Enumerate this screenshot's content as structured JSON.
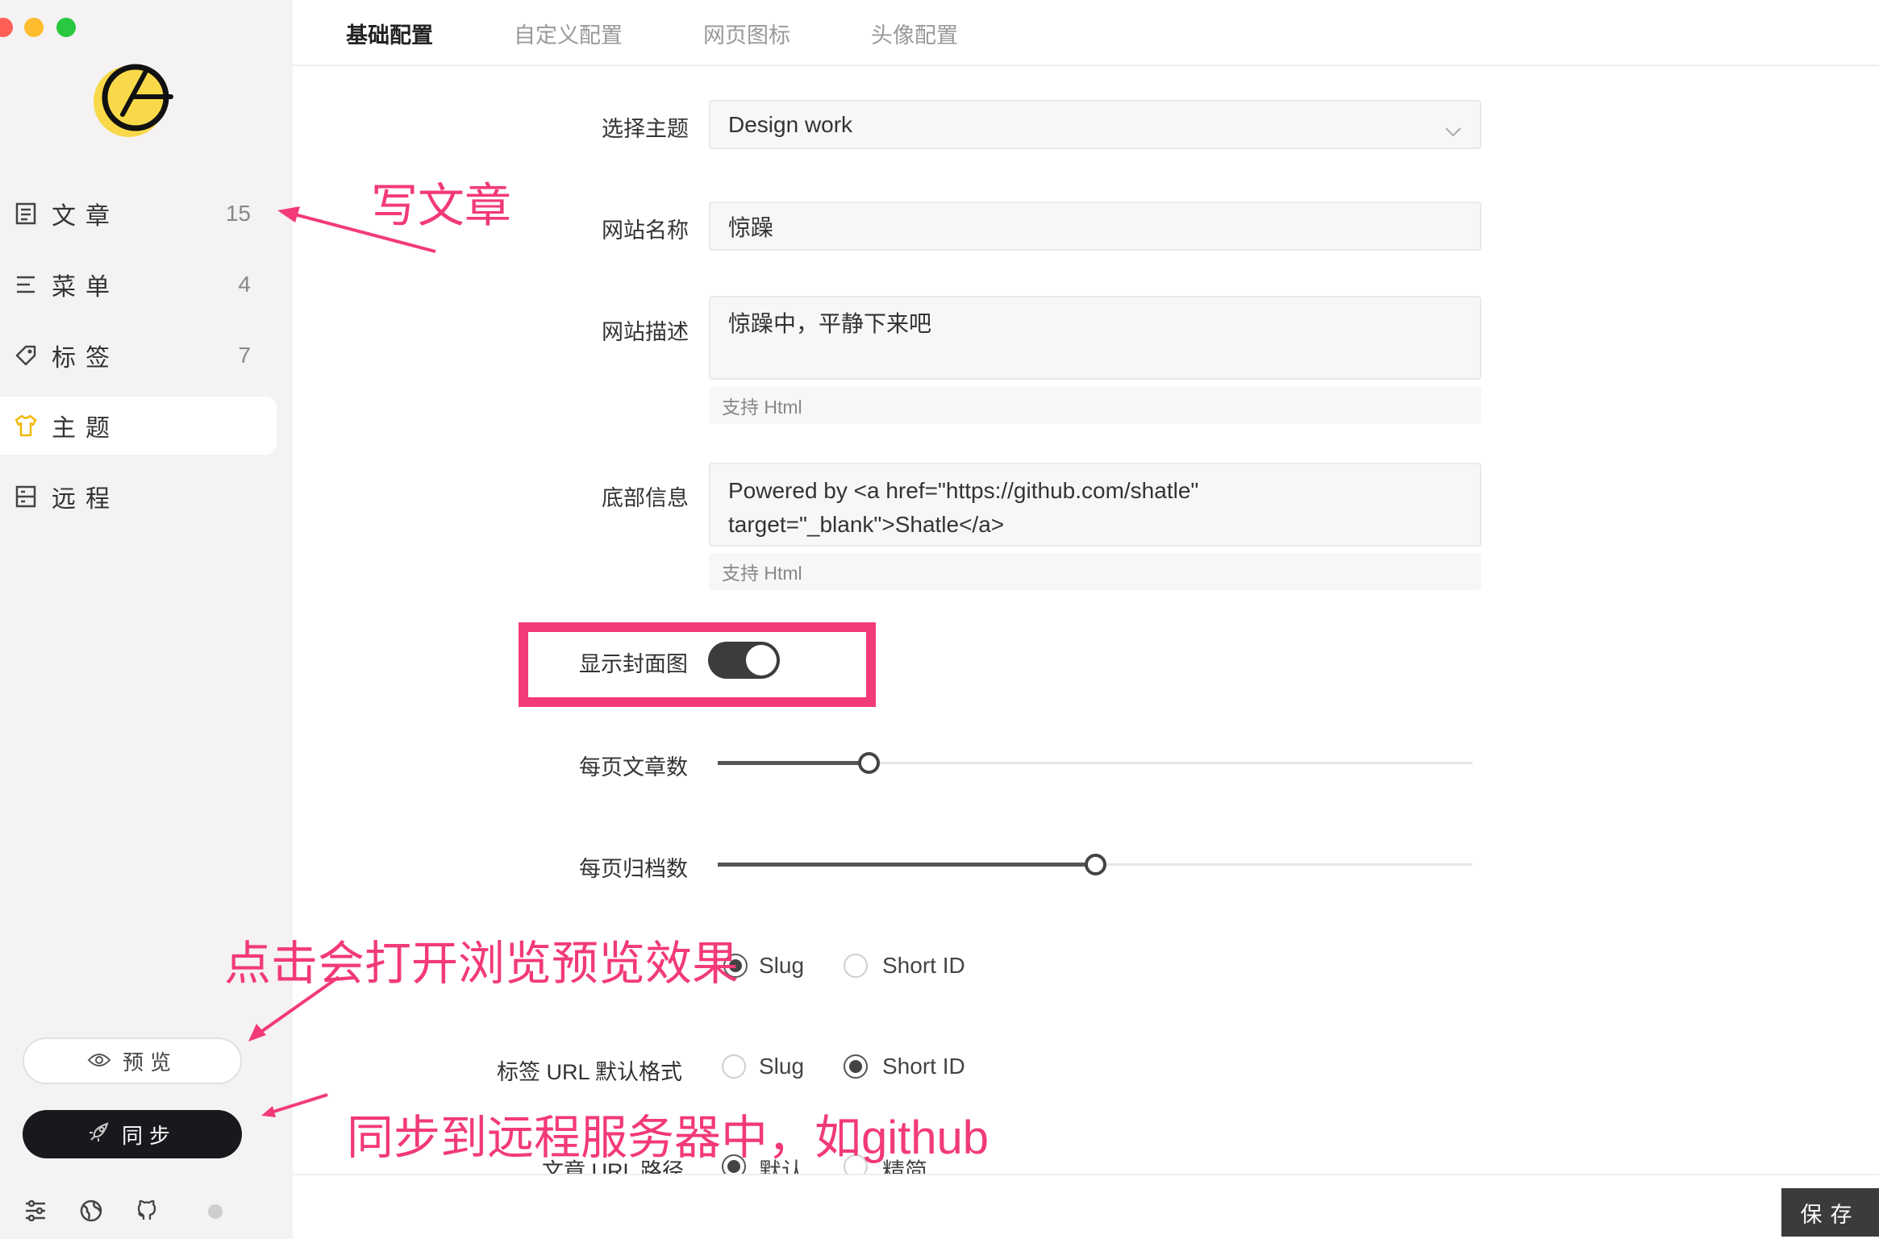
{
  "sidebar": {
    "nav": [
      {
        "label": "文章",
        "count": "15",
        "icon": "document-icon"
      },
      {
        "label": "菜单",
        "count": "4",
        "icon": "menu-lines-icon"
      },
      {
        "label": "标签",
        "count": "7",
        "icon": "tag-icon"
      },
      {
        "label": "主题",
        "count": "",
        "icon": "tshirt-icon"
      },
      {
        "label": "远程",
        "count": "",
        "icon": "server-icon"
      }
    ],
    "preview_label": "预览",
    "sync_label": "同步",
    "footer_icons": [
      "settings-sliders-icon",
      "globe-icon",
      "github-icon"
    ]
  },
  "tabs": [
    "基础配置",
    "自定义配置",
    "网页图标",
    "头像配置"
  ],
  "form": {
    "theme": {
      "label": "选择主题",
      "value": "Design work"
    },
    "site_name": {
      "label": "网站名称",
      "value": "惊躁"
    },
    "site_desc": {
      "label": "网站描述",
      "value": "惊躁中，平静下来吧",
      "hint": "支持 Html"
    },
    "footer_info": {
      "label": "底部信息",
      "value_line1": "Powered by <a href=\"https://github.com/shatle\"",
      "value_line2": "target=\"_blank\">Shatle</a>",
      "hint": "支持 Html"
    },
    "show_cover": {
      "label": "显示封面图",
      "on": true
    },
    "posts_per_page": {
      "label": "每页文章数",
      "level": 0.2
    },
    "archives_per_page": {
      "label": "每页归档数",
      "level": 0.5
    },
    "post_url_format": {
      "options": [
        "Slug",
        "Short ID"
      ],
      "selected": "Slug"
    },
    "tag_url_format": {
      "label": "标签 URL 默认格式",
      "options": [
        "Slug",
        "Short ID"
      ],
      "selected": "Short ID"
    },
    "post_url_path": {
      "label": "文章 URL 路径",
      "options": [
        "默认",
        "精简"
      ],
      "selected": "默认"
    }
  },
  "save_label": "保存",
  "annotations": {
    "write_post": "写文章",
    "preview_hint": "点击会打开浏览预览效果",
    "sync_hint": "同步到远程服务器中，如github"
  },
  "colors": {
    "annotation": "#f23a76",
    "sidebar_bg": "#f4f2f3",
    "accent_yellow": "#f9d949"
  }
}
